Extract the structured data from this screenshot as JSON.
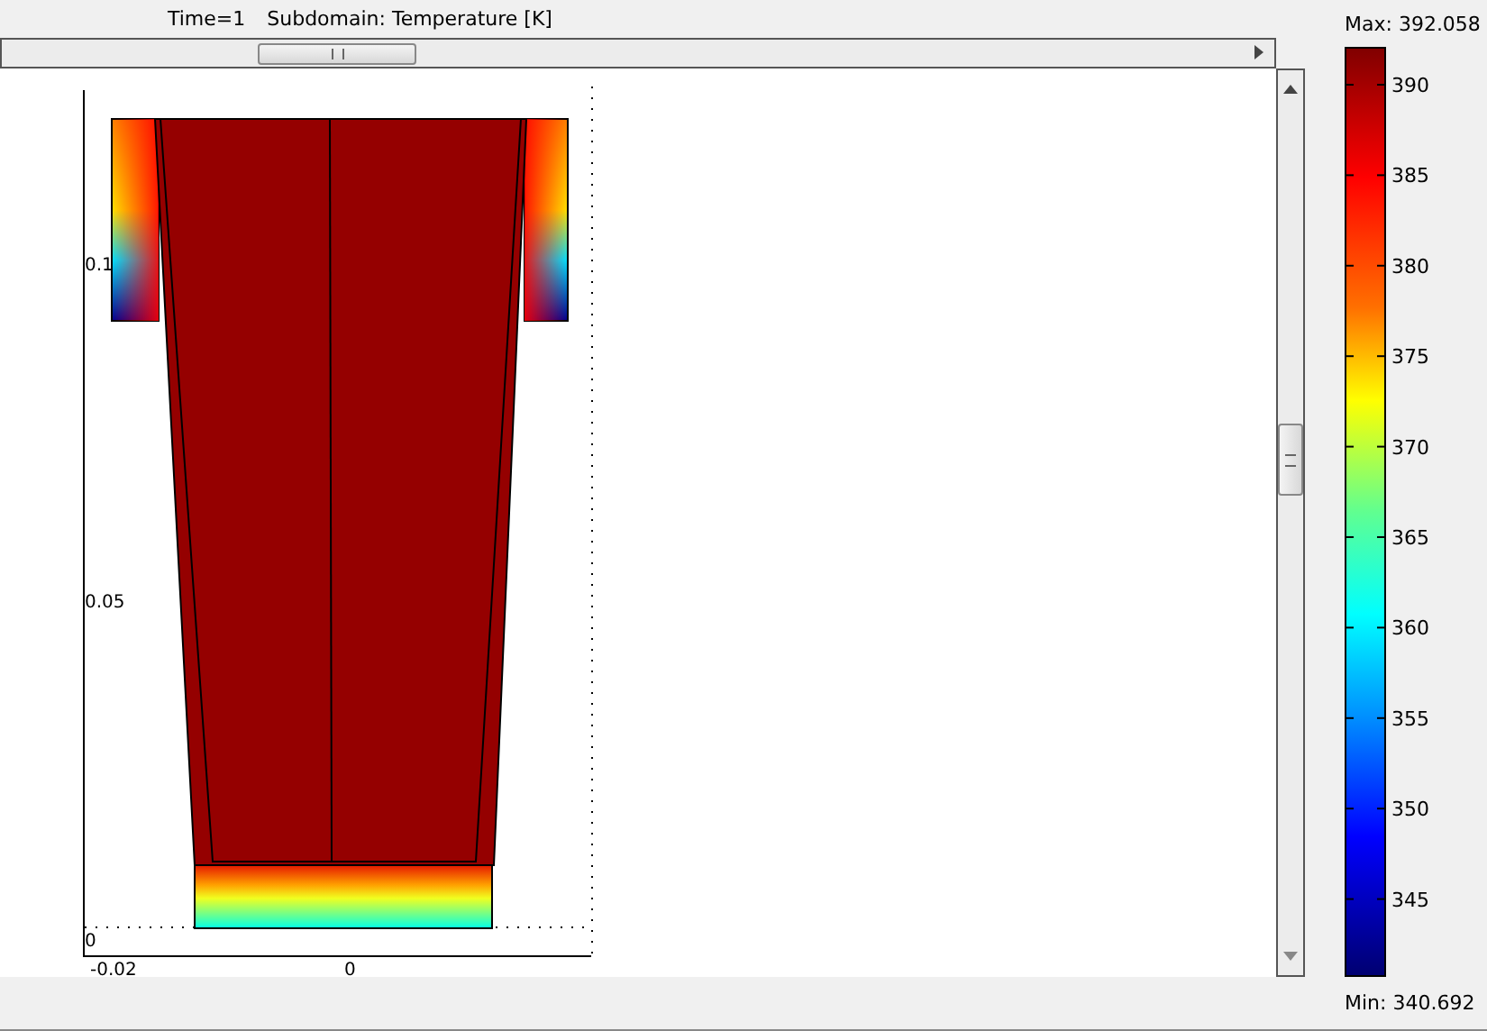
{
  "header": {
    "time": "Time=1",
    "title": "Subdomain: Temperature [K]"
  },
  "plot": {
    "y_ticks": [
      "0.1",
      "0.05",
      "0"
    ],
    "x_ticks": [
      "-0.02",
      "0"
    ]
  },
  "colorbar": {
    "max_label": "Max: 392.058",
    "min_label": "Min: 340.692",
    "ticks": [
      "390",
      "385",
      "380",
      "375",
      "370",
      "365",
      "360",
      "355",
      "350",
      "345"
    ]
  }
}
